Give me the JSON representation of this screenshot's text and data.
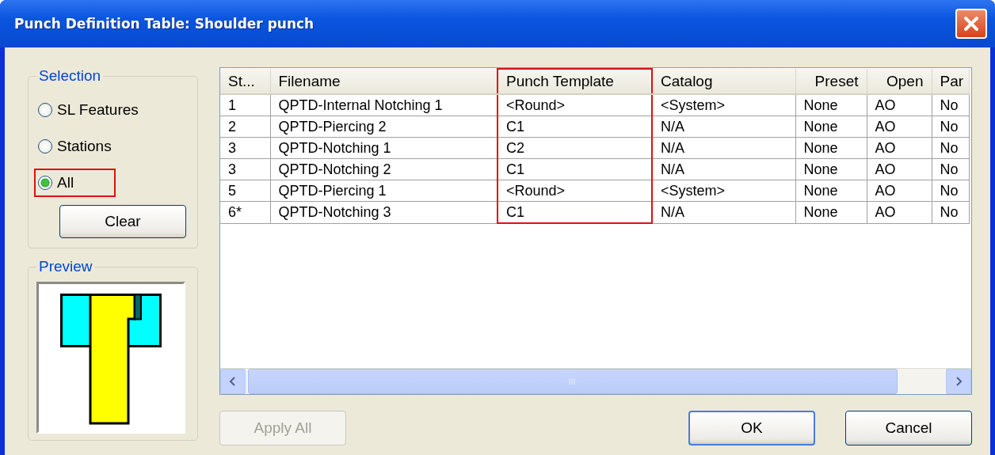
{
  "window": {
    "title": "Punch Definition Table: Shoulder punch"
  },
  "selection": {
    "title": "Selection",
    "options": [
      {
        "label": "SL Features",
        "selected": false,
        "highlighted": false
      },
      {
        "label": "Stations",
        "selected": false,
        "highlighted": false
      },
      {
        "label": "All",
        "selected": true,
        "highlighted": true
      }
    ],
    "clear_button": "Clear"
  },
  "preview": {
    "title": "Preview"
  },
  "table": {
    "columns": [
      {
        "label": "St...",
        "highlighted": false
      },
      {
        "label": "Filename",
        "highlighted": false
      },
      {
        "label": "Punch Template",
        "highlighted": true
      },
      {
        "label": "Catalog",
        "highlighted": false
      },
      {
        "label": "Preset",
        "highlighted": false
      },
      {
        "label": "Open",
        "highlighted": false
      },
      {
        "label": "Par",
        "highlighted": false
      }
    ],
    "rows": [
      [
        "1",
        "QPTD-Internal Notching 1",
        "<Round>",
        "<System>",
        "None",
        "AO",
        "No"
      ],
      [
        "2",
        "QPTD-Piercing 2",
        "C1",
        "N/A",
        "None",
        "AO",
        "No"
      ],
      [
        "3",
        "QPTD-Notching 1",
        "C2",
        "N/A",
        "None",
        "AO",
        "No"
      ],
      [
        "3",
        "QPTD-Notching 2",
        "C1",
        "N/A",
        "None",
        "AO",
        "No"
      ],
      [
        "5",
        "QPTD-Piercing 1",
        "<Round>",
        "<System>",
        "None",
        "AO",
        "No"
      ],
      [
        "6*",
        "QPTD-Notching 3",
        "C1",
        "N/A",
        "None",
        "AO",
        "No"
      ]
    ]
  },
  "buttons": [
    {
      "label": "Apply All",
      "disabled": true,
      "default": false
    },
    {
      "label": "OK",
      "disabled": false,
      "default": true
    },
    {
      "label": "Cancel",
      "disabled": false,
      "default": false
    }
  ]
}
